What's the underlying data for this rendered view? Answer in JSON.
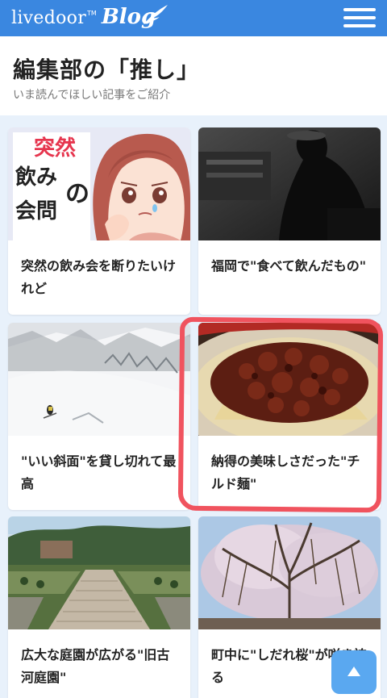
{
  "header": {
    "brand": "livedoor",
    "brand_tm": "TM",
    "blog": "Blog",
    "menu_icon": "hamburger-menu-icon"
  },
  "section": {
    "title": "編集部の「推し」",
    "subtitle": "いま読んでほしい記事をご紹介"
  },
  "thumb1": {
    "lines": [
      "突然",
      "飲み",
      "会問"
    ],
    "particle": "の"
  },
  "articles": [
    {
      "title": "突然の飲み会を断りたいけれど"
    },
    {
      "title": "福岡で\"食べて飲んだもの\""
    },
    {
      "title": "\"いい斜面\"を貸し切れて最高"
    },
    {
      "title": "納得の美味しさだった\"チルド麺\""
    },
    {
      "title": "広大な庭園が広がる\"旧古河庭園\""
    },
    {
      "title": "町中に\"しだれ桜\"が咲き誇る"
    }
  ],
  "scroll_top_icon": "arrow-up-icon",
  "colors": {
    "header": "#3a87e0",
    "highlight": "#f0535e",
    "top_button": "#5aa8f0"
  }
}
